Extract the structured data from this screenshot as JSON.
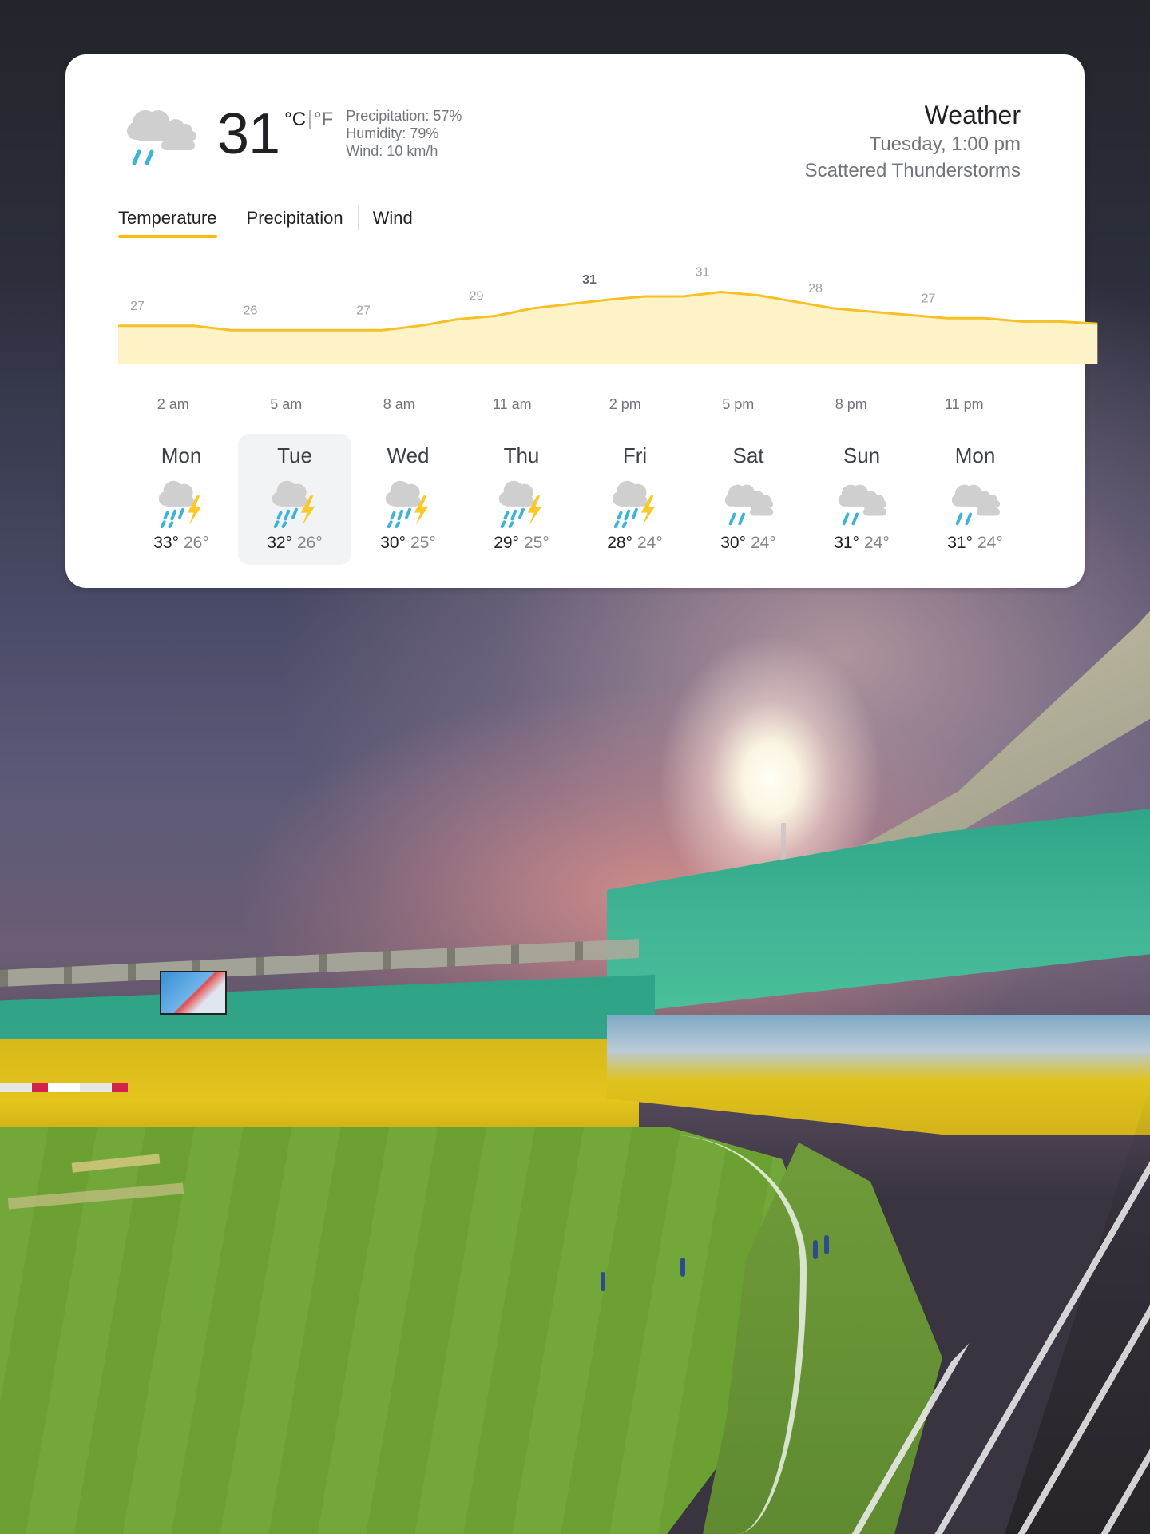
{
  "weather": {
    "current": {
      "icon": "cloudy-rain-icon",
      "temperature": "31",
      "unit_c": "°C",
      "unit_f": "°F",
      "precipitation": "Precipitation: 57%",
      "humidity": "Humidity: 79%",
      "wind": "Wind: 10 km/h"
    },
    "header": {
      "title": "Weather",
      "datetime": "Tuesday, 1:00 pm",
      "condition": "Scattered Thunderstorms"
    },
    "tabs": [
      {
        "label": "Temperature",
        "active": true
      },
      {
        "label": "Precipitation",
        "active": false
      },
      {
        "label": "Wind",
        "active": false
      }
    ],
    "forecast": [
      {
        "day": "Mon",
        "icon": "thunderstorm-icon",
        "high": "33°",
        "low": "26°",
        "selected": false
      },
      {
        "day": "Tue",
        "icon": "thunderstorm-icon",
        "high": "32°",
        "low": "26°",
        "selected": true
      },
      {
        "day": "Wed",
        "icon": "thunderstorm-icon",
        "high": "30°",
        "low": "25°",
        "selected": false
      },
      {
        "day": "Thu",
        "icon": "thunderstorm-icon",
        "high": "29°",
        "low": "25°",
        "selected": false
      },
      {
        "day": "Fri",
        "icon": "thunderstorm-icon",
        "high": "28°",
        "low": "24°",
        "selected": false
      },
      {
        "day": "Sat",
        "icon": "cloudy-rain-icon",
        "high": "30°",
        "low": "24°",
        "selected": false
      },
      {
        "day": "Sun",
        "icon": "cloudy-rain-icon",
        "high": "31°",
        "low": "24°",
        "selected": false
      },
      {
        "day": "Mon",
        "icon": "cloudy-rain-icon",
        "high": "31°",
        "low": "24°",
        "selected": false
      }
    ],
    "colors": {
      "accent": "#fbbc04",
      "area_fill": "#fef3c7",
      "rain": "#3bb4d8",
      "cloud": "#cfcfcf",
      "bolt": "#f9c929"
    }
  },
  "chart_data": {
    "type": "area",
    "title": "Temperature",
    "x": [
      "2 am",
      "5 am",
      "8 am",
      "11 am",
      "2 pm",
      "5 pm",
      "8 pm",
      "11 pm"
    ],
    "labels": [
      "27",
      "26",
      "27",
      "29",
      "31",
      "31",
      "28",
      "27"
    ],
    "highlighted_index": 4,
    "series": [
      {
        "name": "Temperature (°C)",
        "points": [
          {
            "hour": 0,
            "value": 27
          },
          {
            "hour": 2,
            "value": 27
          },
          {
            "hour": 3,
            "value": 26.6
          },
          {
            "hour": 5,
            "value": 26.6
          },
          {
            "hour": 7,
            "value": 26.6
          },
          {
            "hour": 8,
            "value": 27
          },
          {
            "hour": 9,
            "value": 27.6
          },
          {
            "hour": 10,
            "value": 27.9
          },
          {
            "hour": 11,
            "value": 28.6
          },
          {
            "hour": 12,
            "value": 29.0
          },
          {
            "hour": 13,
            "value": 29.4
          },
          {
            "hour": 14,
            "value": 29.7
          },
          {
            "hour": 15,
            "value": 29.7
          },
          {
            "hour": 16,
            "value": 30.1
          },
          {
            "hour": 17,
            "value": 29.8
          },
          {
            "hour": 18,
            "value": 29.2
          },
          {
            "hour": 19,
            "value": 28.6
          },
          {
            "hour": 20,
            "value": 28.3
          },
          {
            "hour": 21,
            "value": 28.0
          },
          {
            "hour": 22,
            "value": 27.7
          },
          {
            "hour": 23,
            "value": 27.7
          },
          {
            "hour": 24,
            "value": 27.4
          },
          {
            "hour": 25,
            "value": 27.4
          },
          {
            "hour": 26,
            "value": 27.2
          }
        ]
      }
    ],
    "ylim": [
      22,
      33
    ],
    "grid": false,
    "legend": "none"
  }
}
